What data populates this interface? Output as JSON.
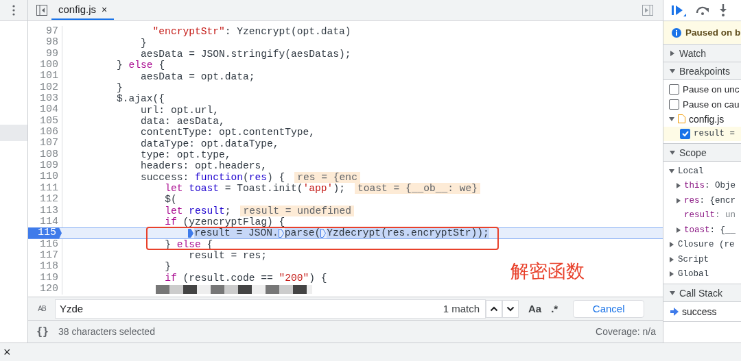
{
  "editor": {
    "tabs": [
      {
        "label": "config.js",
        "close": "×",
        "selected": true
      }
    ],
    "lines": [
      {
        "number": "97",
        "current": false,
        "segments": [
          {
            "kind": "string",
            "text": "              \"encryptStr\""
          },
          {
            "kind": "plain",
            "text": ": Yzencrypt(opt.data)"
          }
        ]
      },
      {
        "number": "98",
        "current": false,
        "segments": [
          {
            "kind": "plain",
            "text": "            }"
          }
        ]
      },
      {
        "number": "99",
        "current": false,
        "segments": [
          {
            "kind": "plain",
            "text": "            aesData = JSON.stringify(aesDatas);"
          }
        ]
      },
      {
        "number": "100",
        "current": false,
        "segments": [
          {
            "kind": "plain",
            "text": "        } "
          },
          {
            "kind": "keyword",
            "text": "else"
          },
          {
            "kind": "plain",
            "text": " {"
          }
        ]
      },
      {
        "number": "101",
        "current": false,
        "segments": [
          {
            "kind": "plain",
            "text": "            aesData = opt.data;"
          }
        ]
      },
      {
        "number": "102",
        "current": false,
        "segments": [
          {
            "kind": "plain",
            "text": "        }"
          }
        ]
      },
      {
        "number": "103",
        "current": false,
        "segments": [
          {
            "kind": "plain",
            "text": "        $.ajax({"
          }
        ]
      },
      {
        "number": "104",
        "current": false,
        "segments": [
          {
            "kind": "plain",
            "text": "            url: opt.url,"
          }
        ]
      },
      {
        "number": "105",
        "current": false,
        "segments": [
          {
            "kind": "plain",
            "text": "            data: aesData,"
          }
        ]
      },
      {
        "number": "106",
        "current": false,
        "segments": [
          {
            "kind": "plain",
            "text": "            contentType: opt.contentType,"
          }
        ]
      },
      {
        "number": "107",
        "current": false,
        "segments": [
          {
            "kind": "plain",
            "text": "            dataType: opt.dataType,"
          }
        ]
      },
      {
        "number": "108",
        "current": false,
        "segments": [
          {
            "kind": "plain",
            "text": "            type: opt.type,"
          }
        ]
      },
      {
        "number": "109",
        "current": false,
        "segments": [
          {
            "kind": "plain",
            "text": "            headers: opt.headers,"
          }
        ]
      },
      {
        "number": "110",
        "current": false,
        "segments": [
          {
            "kind": "plain",
            "text": "            success: "
          },
          {
            "kind": "param",
            "text": "function"
          },
          {
            "kind": "plain",
            "text": "("
          },
          {
            "kind": "param",
            "text": "res"
          },
          {
            "kind": "plain",
            "text": ") {"
          }
        ],
        "inline_value": "res = {enc"
      },
      {
        "number": "111",
        "current": false,
        "segments": [
          {
            "kind": "keyword",
            "text": "                let"
          },
          {
            "kind": "param",
            "text": " toast"
          },
          {
            "kind": "plain",
            "text": " = Toast.init("
          },
          {
            "kind": "string",
            "text": "'app'"
          },
          {
            "kind": "plain",
            "text": ");"
          }
        ],
        "inline_value": "toast = {__ob__: we}"
      },
      {
        "number": "112",
        "current": false,
        "segments": [
          {
            "kind": "plain",
            "text": "                $("
          }
        ]
      },
      {
        "number": "113",
        "current": false,
        "segments": [
          {
            "kind": "keyword",
            "text": "                let"
          },
          {
            "kind": "param",
            "text": " result"
          },
          {
            "kind": "plain",
            "text": ";"
          }
        ],
        "inline_value": "result = undefined"
      },
      {
        "number": "114",
        "current": false,
        "segments": [
          {
            "kind": "keyword",
            "text": "                if"
          },
          {
            "kind": "plain",
            "text": " (yzencryptFlag) {"
          }
        ]
      },
      {
        "number": "115",
        "current": true,
        "segments": [
          {
            "kind": "selected",
            "text": "                    result = JSON.",
            "marker": true,
            "marker_filled": true
          },
          {
            "kind": "selected",
            "text": "parse(",
            "marker": true,
            "marker_filled": false
          },
          {
            "kind": "selected",
            "text": "Yzdecrypt(res.encryptStr));",
            "marker": true,
            "marker_filled": false
          }
        ]
      },
      {
        "number": "116",
        "current": false,
        "segments": [
          {
            "kind": "plain",
            "text": "                } "
          },
          {
            "kind": "keyword",
            "text": "else"
          },
          {
            "kind": "plain",
            "text": " {"
          }
        ]
      },
      {
        "number": "117",
        "current": false,
        "segments": [
          {
            "kind": "plain",
            "text": "                    result = res;"
          }
        ]
      },
      {
        "number": "118",
        "current": false,
        "segments": [
          {
            "kind": "plain",
            "text": "                }"
          }
        ]
      },
      {
        "number": "119",
        "current": false,
        "segments": [
          {
            "kind": "keyword",
            "text": "                if"
          },
          {
            "kind": "plain",
            "text": " (result.code == "
          },
          {
            "kind": "string",
            "text": "\"200\""
          },
          {
            "kind": "plain",
            "text": ") {"
          }
        ]
      },
      {
        "number": "120",
        "current": false
      }
    ],
    "annotation": {
      "label": "解密函数"
    }
  },
  "search": {
    "replace_toggle": "AB",
    "value": "Yzde",
    "match_count": "1 match",
    "case_button": "Aa",
    "regex_button": ".*",
    "cancel": "Cancel"
  },
  "status_bar": {
    "format_button": "{}",
    "selection": "38 characters selected",
    "coverage": "Coverage: n/a"
  },
  "debugger": {
    "paused_message": "Paused on b",
    "sections": [
      {
        "title": "Watch",
        "expanded": false
      },
      {
        "title": "Breakpoints",
        "expanded": true,
        "items": [
          {
            "kind": "checkbox",
            "label": "Pause on unc",
            "checked": false
          },
          {
            "kind": "checkbox",
            "label": "Pause on cau",
            "checked": false
          },
          {
            "kind": "file",
            "label": "config.js",
            "expanded": true
          },
          {
            "kind": "breakpoint",
            "label": "result =",
            "checked": true
          }
        ]
      },
      {
        "title": "Scope",
        "expanded": true,
        "items": [
          {
            "kind": "scope",
            "label": "Local",
            "expanded": true,
            "children": [
              {
                "kind": "object",
                "name": "this",
                "value": ": Obje",
                "expanded": false
              },
              {
                "kind": "object",
                "name": "res",
                "value": ": {encr",
                "expanded": false
              },
              {
                "kind": "value",
                "name": "result",
                "value": ": un"
              },
              {
                "kind": "object",
                "name": "toast",
                "value": ": {__",
                "expanded": false
              }
            ]
          },
          {
            "kind": "scope",
            "label": "Closure (re",
            "expanded": false
          },
          {
            "kind": "scope",
            "label": "Script",
            "expanded": false
          },
          {
            "kind": "scope",
            "label": "Global",
            "expanded": false
          }
        ]
      },
      {
        "title": "Call Stack",
        "expanded": true,
        "items": [
          {
            "kind": "frame",
            "label": "success",
            "selected": true
          }
        ]
      }
    ]
  },
  "drawer": {
    "close": "×"
  }
}
